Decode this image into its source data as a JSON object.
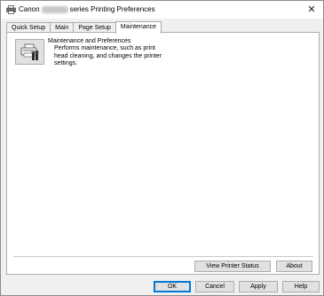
{
  "window": {
    "title_prefix": "Canon",
    "title_suffix": "series Printing Preferences",
    "close_glyph": "✕"
  },
  "tabs": [
    {
      "label": "Quick Setup",
      "active": false
    },
    {
      "label": "Main",
      "active": false
    },
    {
      "label": "Page Setup",
      "active": false
    },
    {
      "label": "Maintenance",
      "active": true
    }
  ],
  "maintenance": {
    "tool_title": "Maintenance and Preferences",
    "tool_description": "Performs maintenance, such as print head cleaning, and changes the printer settings.",
    "tool_icon": "printer-maintenance-icon"
  },
  "panel_buttons": {
    "view_printer_status": "View Printer Status",
    "about": "About"
  },
  "dialog_buttons": {
    "ok": "OK",
    "cancel": "Cancel",
    "apply": "Apply",
    "help": "Help"
  },
  "colors": {
    "focus_border": "#0078d7",
    "button_face": "#e1e1e1",
    "dialog_background": "#f0f0f0"
  }
}
